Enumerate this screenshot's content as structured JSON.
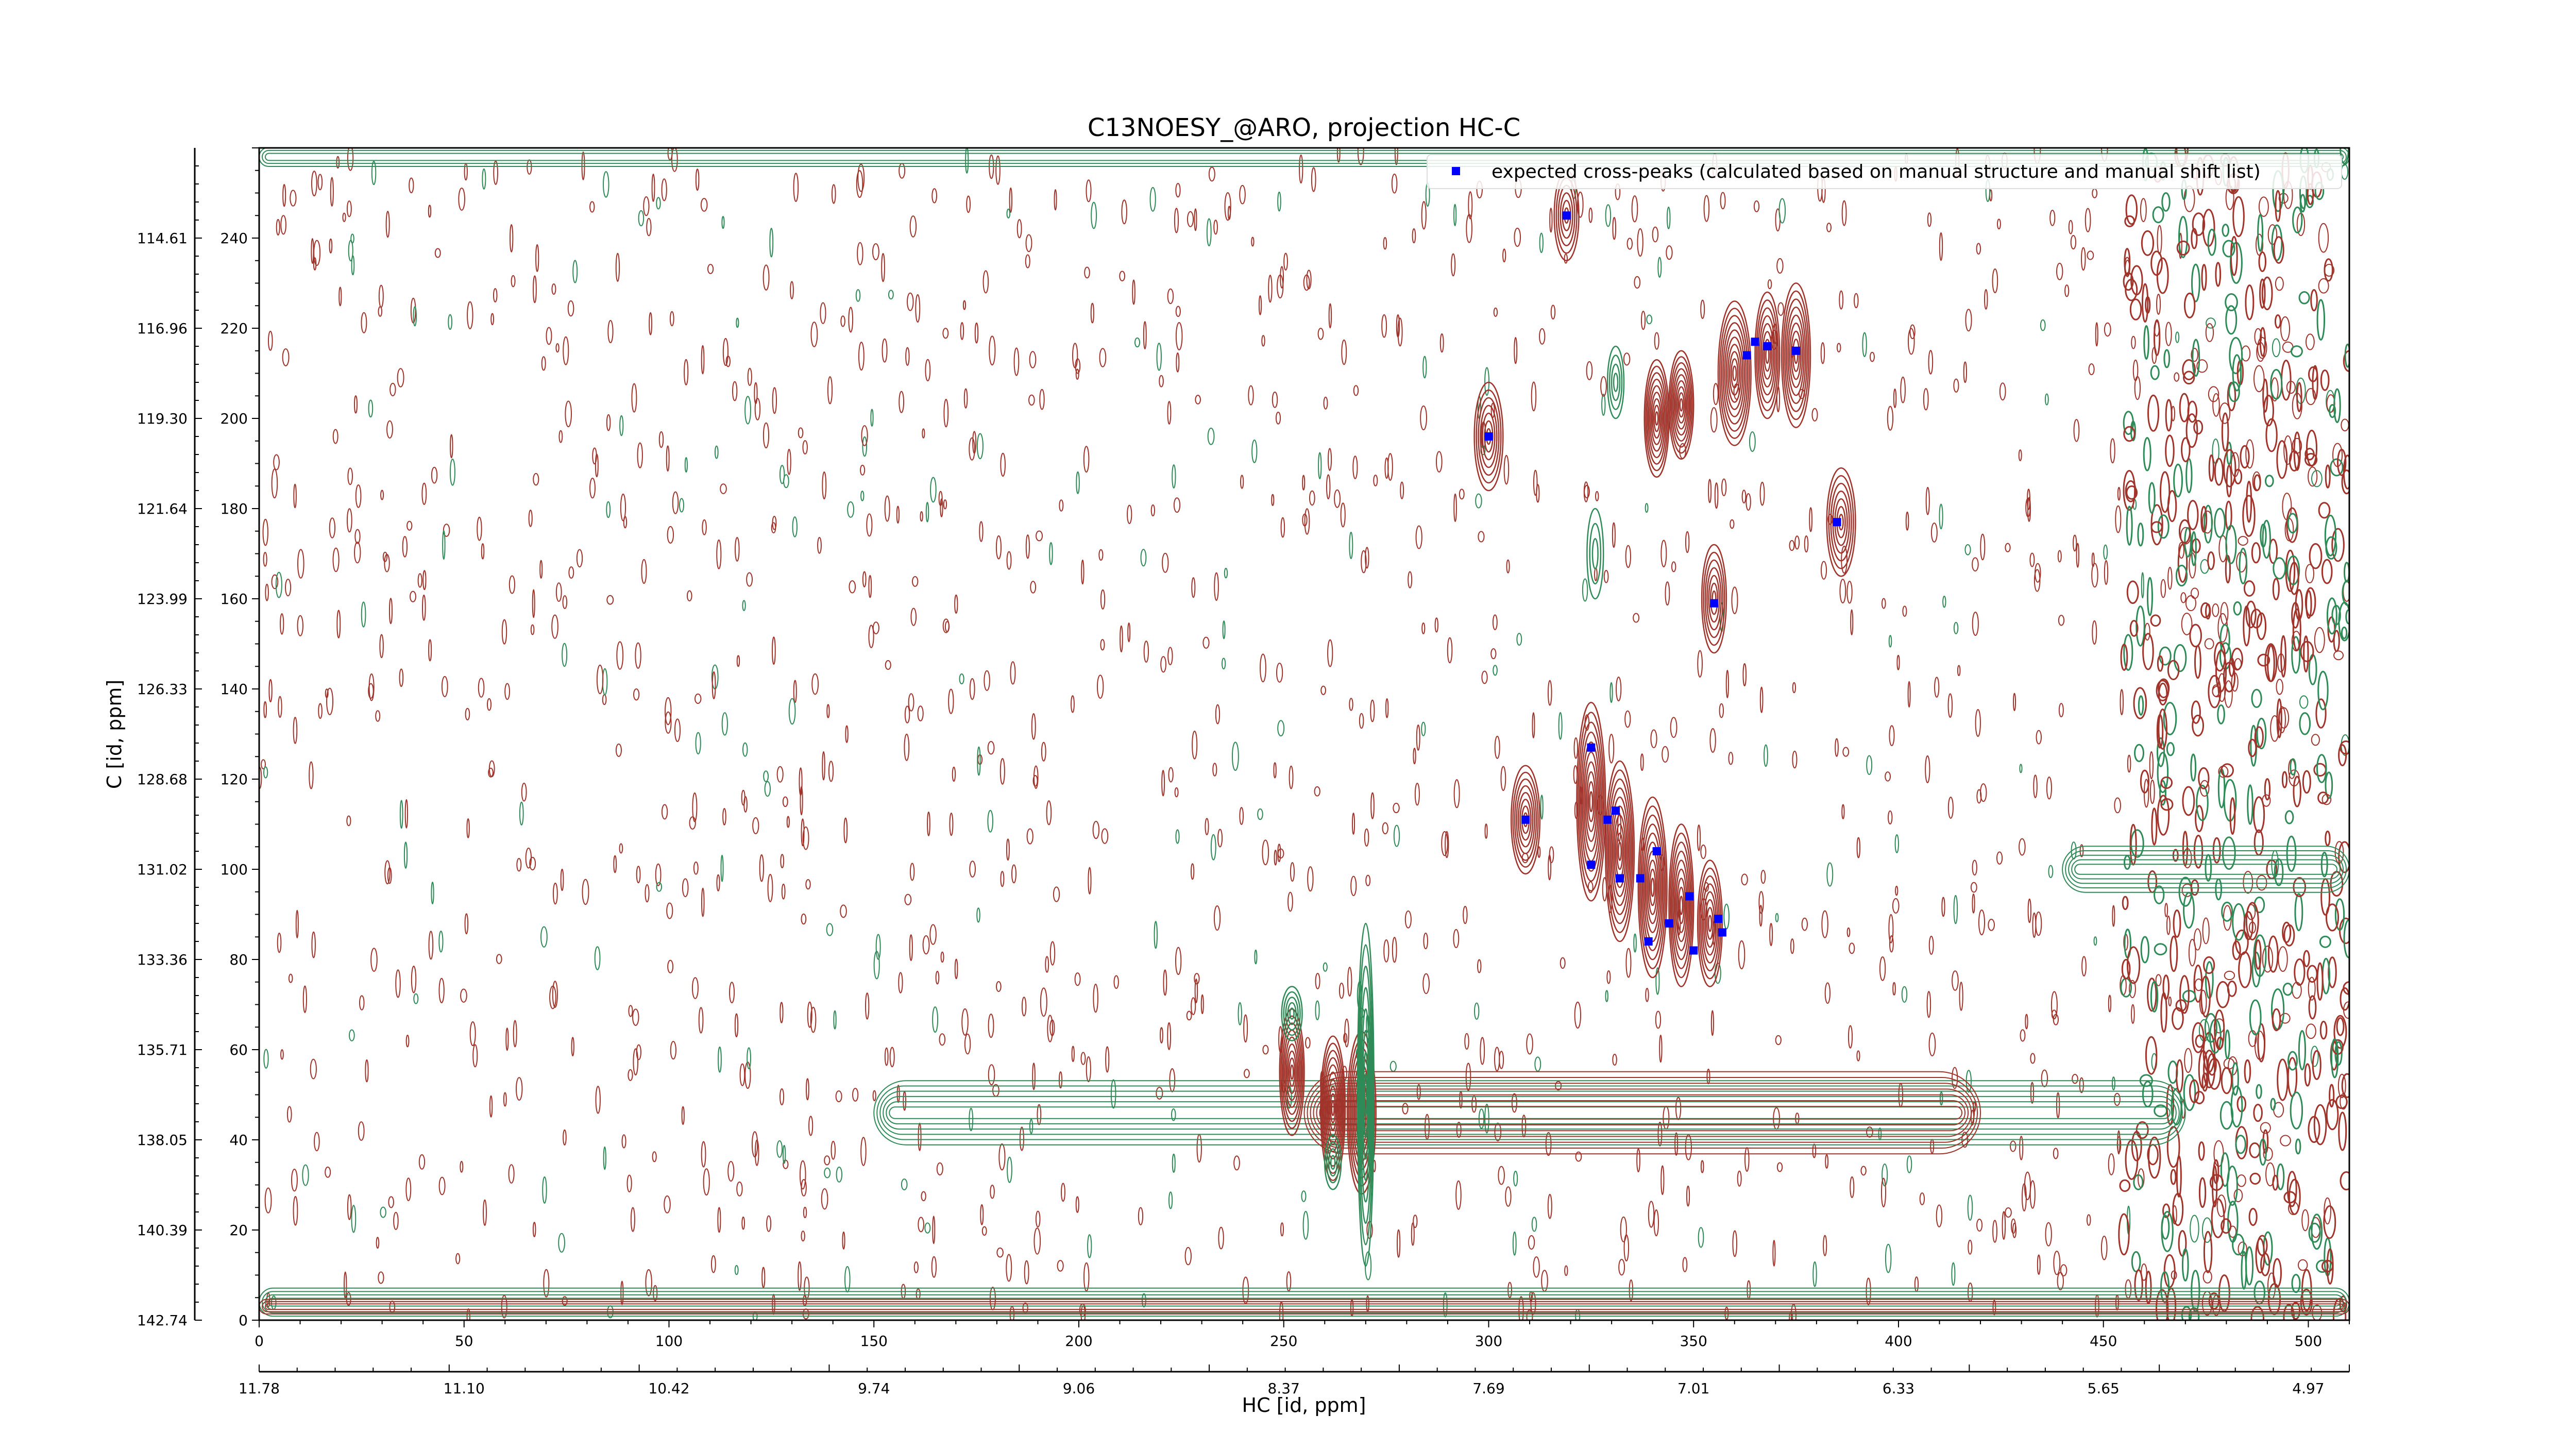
{
  "chart_data": {
    "type": "contour",
    "title": "C13NOESY_@ARO, projection HC-C",
    "xlabel": "HC [id, ppm]",
    "ylabel": "C [id, ppm]",
    "xlim": [
      0,
      510
    ],
    "ylim": [
      0,
      260
    ],
    "x_ticks": [
      0,
      50,
      100,
      150,
      200,
      250,
      300,
      350,
      400,
      450,
      500
    ],
    "y_ticks": [
      0,
      20,
      40,
      60,
      80,
      100,
      120,
      140,
      160,
      180,
      200,
      220,
      240
    ],
    "x_ppm_ticks": [
      "11.78",
      "11.10",
      "10.42",
      "9.74",
      "9.06",
      "8.37",
      "7.69",
      "7.01",
      "6.33",
      "5.65",
      "4.97"
    ],
    "y_ppm_ticks": [
      "142.74",
      "140.39",
      "138.05",
      "135.71",
      "133.36",
      "131.02",
      "128.68",
      "126.33",
      "123.99",
      "121.64",
      "119.30",
      "116.96",
      "114.61"
    ],
    "legend": {
      "label": "expected cross-peaks (calculated based on manual structure and manual shift list)",
      "placement": "top-right",
      "marker_color": "#0000ff"
    },
    "colors": {
      "positive_contour": "#a0332a",
      "negative_contour": "#2e8b57",
      "expected_peak": "#0000ff"
    },
    "series": [
      {
        "name": "expected cross-peaks (calculated based on manual structure and manual shift list)",
        "points": [
          {
            "x": 319,
            "y": 245
          },
          {
            "x": 300,
            "y": 196
          },
          {
            "x": 363,
            "y": 214
          },
          {
            "x": 365,
            "y": 217
          },
          {
            "x": 368,
            "y": 216
          },
          {
            "x": 375,
            "y": 215
          },
          {
            "x": 385,
            "y": 177
          },
          {
            "x": 355,
            "y": 159
          },
          {
            "x": 325,
            "y": 127
          },
          {
            "x": 309,
            "y": 111
          },
          {
            "x": 329,
            "y": 111
          },
          {
            "x": 331,
            "y": 113
          },
          {
            "x": 325,
            "y": 101
          },
          {
            "x": 332,
            "y": 98
          },
          {
            "x": 337,
            "y": 98
          },
          {
            "x": 341,
            "y": 104
          },
          {
            "x": 349,
            "y": 94
          },
          {
            "x": 356,
            "y": 89
          },
          {
            "x": 344,
            "y": 88
          },
          {
            "x": 339,
            "y": 84
          },
          {
            "x": 350,
            "y": 82
          },
          {
            "x": 357,
            "y": 86
          }
        ]
      },
      {
        "name": "",
        "peaks": [
          {
            "x": 252,
            "y": 53
          },
          {
            "x": 262,
            "y": 47
          },
          {
            "x": 268,
            "y": 45
          },
          {
            "x": 271,
            "y": 46
          },
          {
            "x": 341,
            "y": 201
          },
          {
            "x": 347,
            "y": 204
          },
          {
            "x": 363,
            "y": 218
          },
          {
            "x": 375,
            "y": 218
          }
        ]
      }
    ]
  }
}
